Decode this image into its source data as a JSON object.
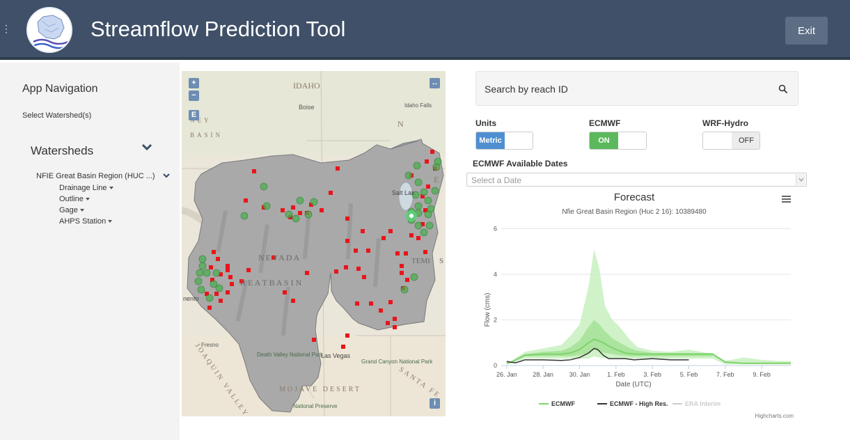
{
  "header": {
    "title": "Streamflow Prediction Tool",
    "exit_label": "Exit",
    "menu_icon": "hamburger-icon",
    "logo_icon": "app-logo-icon"
  },
  "sidebar": {
    "nav_title": "App Navigation",
    "select_link": "Select Watershed(s)",
    "watersheds_title": "Watersheds",
    "basin_name": "NFIE Great Basin Region (HUC ...)",
    "layers": [
      "Drainage Line",
      "Outline",
      "Gage",
      "AHPS Station"
    ]
  },
  "map": {
    "zoom_in": "+",
    "zoom_out": "−",
    "legend_btn": "E",
    "expand_btn": "↔",
    "info_btn": "i",
    "labels": {
      "idaho": "IDAHO",
      "boise": "Boise",
      "idaho_falls": "Idaho Falls",
      "basin_a": "NEY",
      "basin_b": "BASIN",
      "n_letter": "N",
      "e_letter": "E",
      "salt": "Salt Lak",
      "nevada": "NEVADA",
      "great_basin": "R E A T   B A S I N",
      "nento": "nento",
      "fresno": "Fresno",
      "death_valley": "Death Valley National Park",
      "las_vegas": "Las Vegas",
      "grand_canyon": "Grand Canyon National Park",
      "mojave": "MOJAVE DESERT",
      "joaquin": "JOAQUIN VALLEY",
      "national": "National Preserve",
      "santa": "SANTA FE",
      "temple": "TEMI",
      "s_letter": "S"
    },
    "colors": {
      "basin": "#a9a9a9",
      "gage": "#e8151b",
      "station": "#4caf50"
    }
  },
  "search": {
    "placeholder": "Search by reach ID",
    "icon": "search-icon"
  },
  "toggles": {
    "units": {
      "label": "Units",
      "on_text": "Metric",
      "state": "Metric"
    },
    "ecmwf": {
      "label": "ECMWF",
      "on_text": "ON",
      "state": "ON"
    },
    "wrf": {
      "label": "WRF-Hydro",
      "off_text": "OFF",
      "state": "OFF"
    }
  },
  "dates": {
    "label": "ECMWF Available Dates",
    "placeholder": "Select a Date"
  },
  "chart_data": {
    "type": "area",
    "title": "Forecast",
    "subtitle": "Nfie Great Basin Region (Huc 2 16): 10389480",
    "xlabel": "Date (UTC)",
    "ylabel": "Flow (cms)",
    "x_ticks": [
      "26. Jan",
      "28. Jan",
      "30. Jan",
      "1. Feb",
      "3. Feb",
      "5. Feb",
      "7. Feb",
      "9. Feb"
    ],
    "y_ticks": [
      0,
      2,
      4,
      6
    ],
    "ylim": [
      0,
      6.2
    ],
    "x_range_days": [
      -0.3,
      15.6
    ],
    "grid": true,
    "legend": [
      "ECMWF",
      "ECMWF - High Res.",
      "ERA Interim"
    ],
    "legend_position": "bottom",
    "credits": "Highcharts.com",
    "colors": {
      "ecmwf": "#7ed36b",
      "ecmwf_light": "#c8f0c0",
      "highres": "#333333",
      "era": "#cccccc"
    },
    "series": [
      {
        "name": "ECMWF",
        "x": [
          0,
          0.25,
          1,
          2,
          3,
          3.5,
          4,
          4.5,
          4.8,
          5,
          5.3,
          5.6,
          6,
          6.5,
          7,
          8,
          9,
          10,
          11,
          11.3,
          12,
          13,
          14,
          15,
          15.6
        ],
        "y": [
          0.1,
          0.15,
          0.45,
          0.5,
          0.5,
          0.55,
          0.7,
          1.0,
          1.15,
          1.1,
          1.0,
          0.85,
          0.7,
          0.55,
          0.5,
          0.5,
          0.5,
          0.5,
          0.5,
          0.5,
          0.15,
          0.1,
          0.1,
          0.1,
          0.1
        ]
      },
      {
        "name": "ECMWF - High Res.",
        "x": [
          0,
          0.2,
          0.5,
          1,
          2,
          3,
          3.5,
          4,
          4.5,
          4.8,
          5,
          5.3,
          5.6,
          6,
          6.5,
          7,
          8,
          9,
          9.5,
          10
        ],
        "y": [
          0.18,
          0.15,
          0.12,
          0.25,
          0.25,
          0.22,
          0.25,
          0.35,
          0.55,
          0.75,
          0.7,
          0.45,
          0.3,
          0.3,
          0.3,
          0.25,
          0.3,
          0.25,
          0.25,
          0.25
        ]
      }
    ],
    "envelope_outer": {
      "x": [
        0,
        0.25,
        1,
        2,
        3,
        3.5,
        4,
        4.5,
        4.8,
        5.1,
        5.4,
        5.8,
        6.2,
        6.8,
        7.2,
        8,
        9,
        10,
        11,
        11.3,
        12,
        13,
        14,
        15,
        15.6
      ],
      "upper": [
        0.15,
        0.2,
        0.6,
        0.75,
        0.9,
        1.3,
        1.8,
        3.5,
        5.1,
        4.2,
        2.6,
        2.0,
        1.7,
        1.1,
        0.8,
        0.65,
        0.6,
        0.7,
        0.55,
        0.55,
        0.2,
        0.35,
        0.25,
        0.2,
        0.2
      ],
      "lower": [
        0.05,
        0.1,
        0.3,
        0.3,
        0.3,
        0.3,
        0.3,
        0.3,
        0.4,
        0.35,
        0.3,
        0.3,
        0.3,
        0.3,
        0.3,
        0.3,
        0.3,
        0.3,
        0.3,
        0.3,
        0.05,
        0.05,
        0.05,
        0.05,
        0.05
      ]
    },
    "envelope_inner": {
      "x": [
        0,
        0.25,
        1,
        2,
        3,
        3.5,
        4,
        4.5,
        4.8,
        5.1,
        5.4,
        5.8,
        6.2,
        6.8,
        7.2,
        8,
        9,
        10,
        11,
        11.3
      ],
      "upper": [
        0.12,
        0.17,
        0.5,
        0.6,
        0.65,
        0.8,
        1.1,
        1.7,
        2.0,
        1.8,
        1.5,
        1.2,
        1.0,
        0.75,
        0.65,
        0.55,
        0.55,
        0.55,
        0.55,
        0.55
      ],
      "lower": [
        0.08,
        0.12,
        0.4,
        0.4,
        0.4,
        0.4,
        0.45,
        0.55,
        0.7,
        0.6,
        0.55,
        0.5,
        0.45,
        0.4,
        0.4,
        0.4,
        0.4,
        0.4,
        0.4,
        0.4
      ]
    }
  }
}
